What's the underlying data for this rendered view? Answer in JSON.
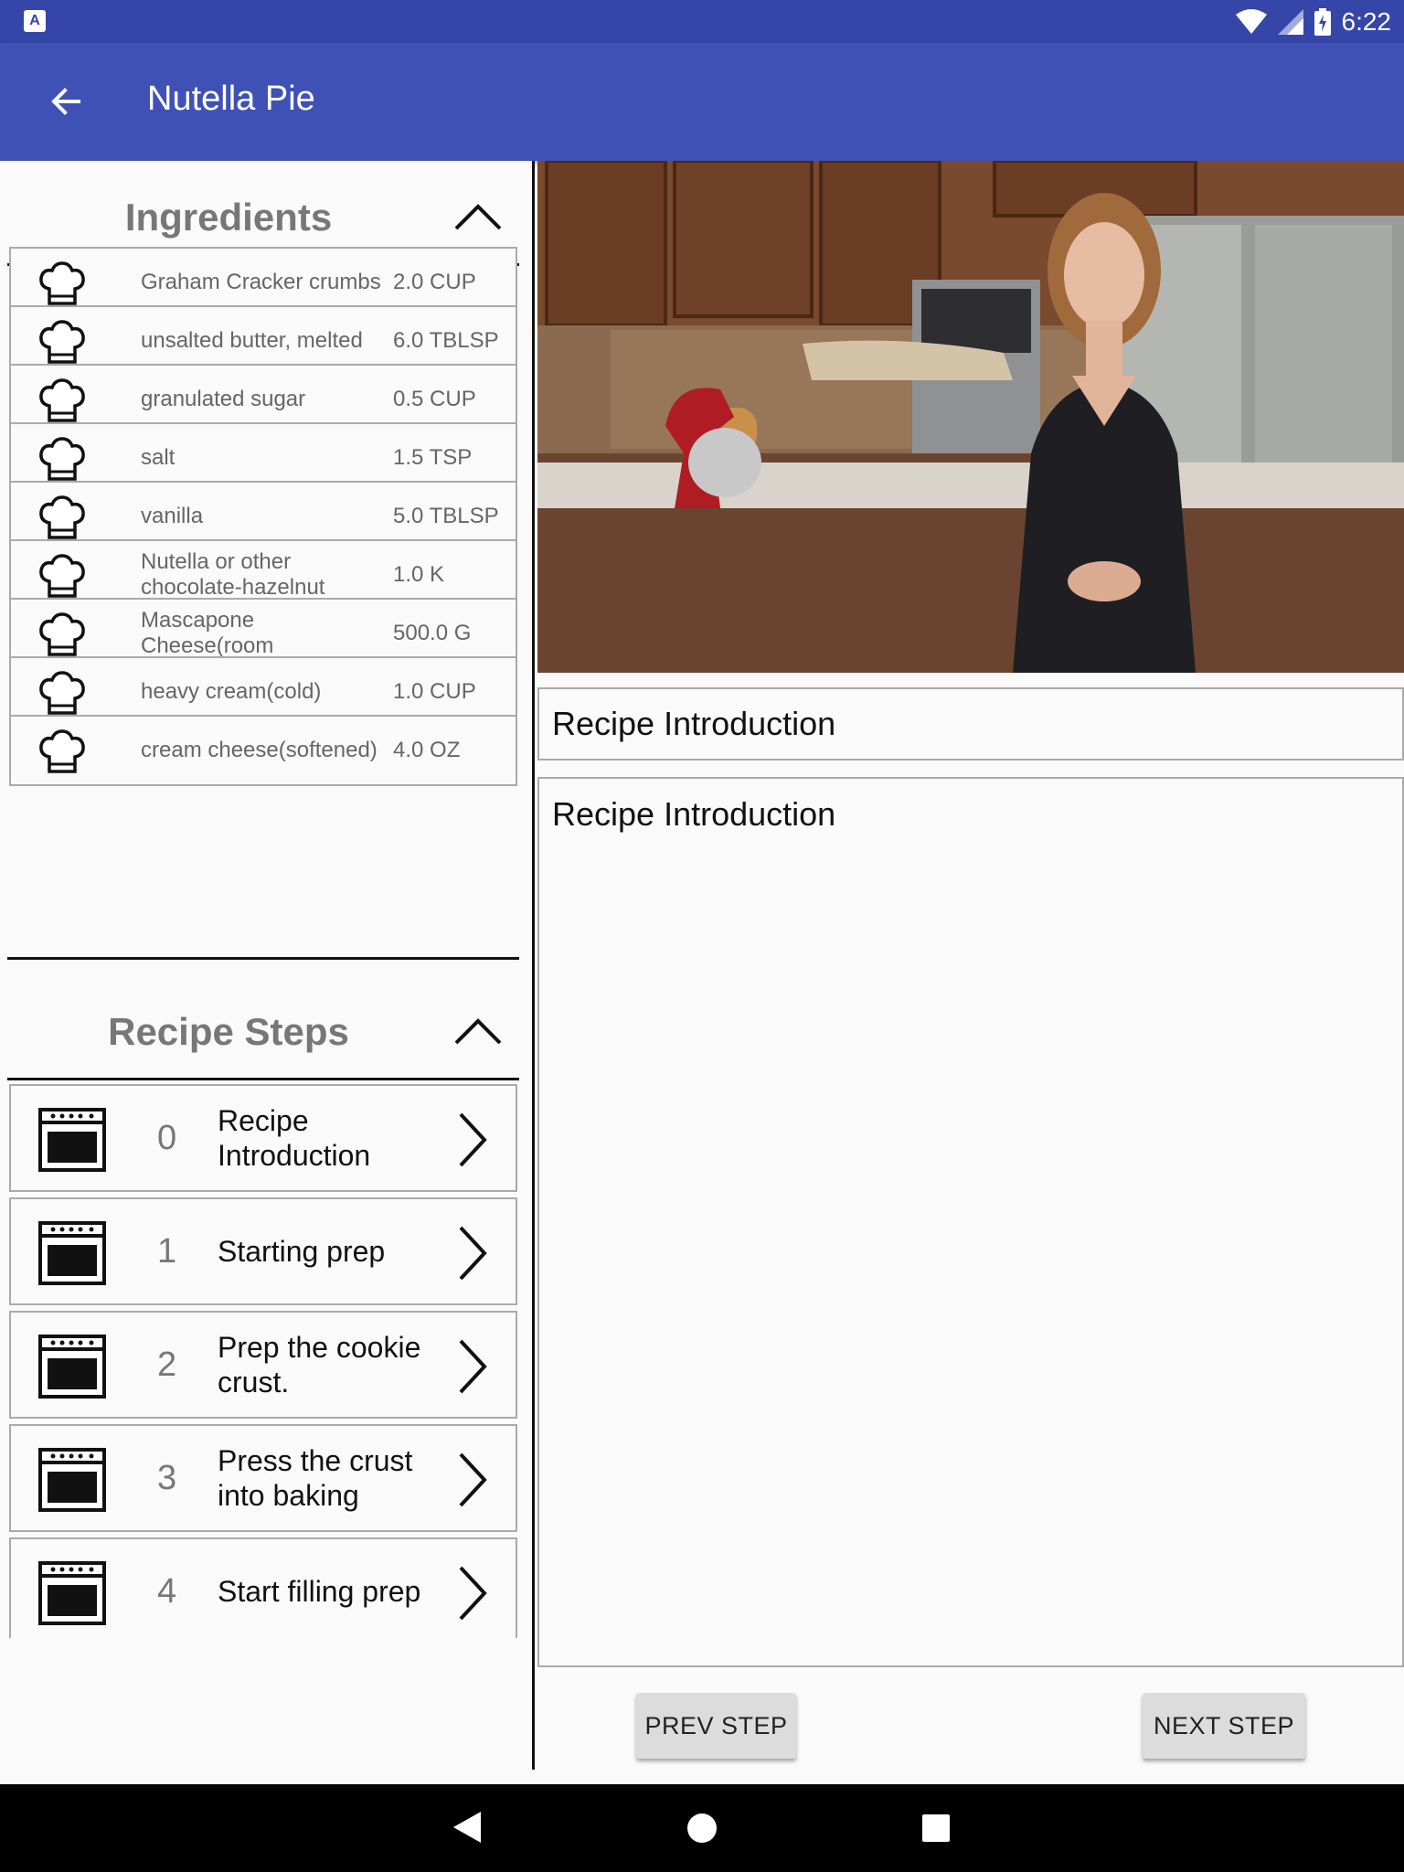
{
  "status_bar": {
    "time": "6:22",
    "left_badge": "A"
  },
  "app_bar": {
    "title": "Nutella Pie"
  },
  "ingredients": {
    "title": "Ingredients",
    "items": [
      {
        "name": "Graham Cracker crumbs",
        "qty": "2.0 CUP"
      },
      {
        "name": "unsalted butter, melted",
        "qty": "6.0 TBLSP"
      },
      {
        "name": "granulated sugar",
        "qty": "0.5 CUP"
      },
      {
        "name": "salt",
        "qty": "1.5 TSP"
      },
      {
        "name": "vanilla",
        "qty": "5.0 TBLSP"
      },
      {
        "name": "Nutella or other chocolate-hazelnut",
        "qty": "1.0 K"
      },
      {
        "name": "Mascapone Cheese(room",
        "qty": "500.0 G"
      },
      {
        "name": "heavy cream(cold)",
        "qty": "1.0 CUP"
      },
      {
        "name": "cream cheese(softened)",
        "qty": "4.0 OZ"
      }
    ]
  },
  "steps": {
    "title": "Recipe Steps",
    "items": [
      {
        "num": "0",
        "label": "Recipe Introduction"
      },
      {
        "num": "1",
        "label": "Starting prep"
      },
      {
        "num": "2",
        "label": "Prep the cookie crust."
      },
      {
        "num": "3",
        "label": "Press the crust into baking"
      },
      {
        "num": "4",
        "label": "Start filling prep"
      }
    ]
  },
  "detail": {
    "short_description": "Recipe Introduction",
    "description": "Recipe Introduction",
    "prev_label": "PREV STEP",
    "next_label": "NEXT STEP"
  },
  "icons": {
    "back": "arrow-left-icon",
    "collapse": "chevron-up-icon",
    "ingredient": "chef-hat-icon",
    "step": "oven-icon",
    "step_arrow": "chevron-right-icon"
  },
  "colors": {
    "app_bar": "#3f51b5",
    "status_bar": "#3546a8"
  }
}
